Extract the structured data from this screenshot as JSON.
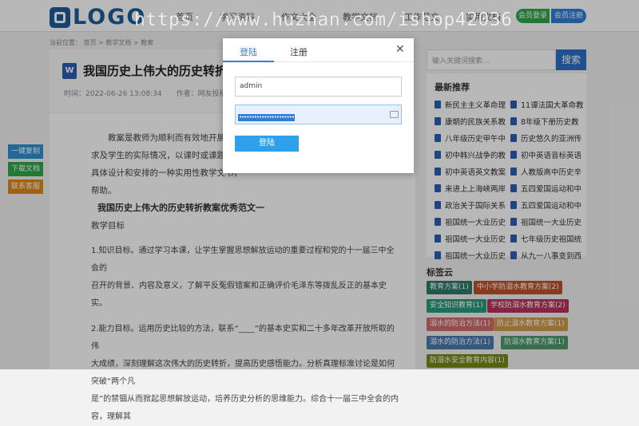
{
  "header": {
    "logo_text": "LOGO",
    "nav": [
      "首页",
      "学习资料",
      "作文大全",
      "教学文档",
      "工作范文",
      "实用文档"
    ],
    "member_login": "会员登录",
    "member_register": "会员注册",
    "watermark": "https://www.huzhan.com/ishop42036"
  },
  "breadcrumb": "当前位置： 首页 > 教学文档 > 教案",
  "article": {
    "title": "我国历史上伟大的历史转折",
    "meta": "时间：2022-06-26 13:08:34　　作者：网友投稿",
    "intro": [
      "教案是教师为顺利而有效地开展教",
      "求及学生的实际情况，以课时或课题为单位",
      "具体设计和安排的一种实用性教学文书，",
      "帮助。"
    ],
    "heading": "我国历史上伟大的历史转折教案优秀范文一",
    "subheading": "教学目标",
    "p1_lines": [
      "1.知识目标。通过学习本课，让学生掌握思想解放运动的重要过程和党的十一届三中全会的",
      "召开的背景、内容及意义，了解平反冤假错案和正确评价毛泽东等拨乱反正的基本史实。"
    ],
    "p2_lines": [
      "2.能力目标。运用历史比较的方法，联系“____”的基本史实和二十多年改革开放所取的伟",
      "大成绩，深刻理解这次伟大的历史转折，提高历史感悟能力。分析真理标准讨论是如何突破“两个凡",
      "是”的禁锢从而掀起思想解放运动，培养历史分析的思维能力。综合十一届三中全会的内容，理解其"
    ]
  },
  "side_buttons": [
    "一键复制",
    "下载文档",
    "联系客服"
  ],
  "sidebar": {
    "search_placeholder": "输入关键词搜索...",
    "search_button": "搜索",
    "recommend_title": "最新推荐",
    "recommend": [
      "新民主主义革命理",
      "11谭法国大革命教",
      "康朝的民族关系教",
      "8年级下册历史教",
      "八年级历史甲午中",
      "历史悠久的亚洲传",
      "初中韩兴战争的教",
      "初中英语音标英语",
      "初中英语英文教案",
      "人教版高中历史辛",
      "来进上上海峡两岸",
      "五四爱国运动和中",
      "政治关于国际关系",
      "五四爱国运动和中",
      "祖国统一大业历史",
      "祖国统一大业历史",
      "祖国统一大业历史",
      "七年级历史祖国统",
      "祖国统一大业历史",
      "从九一八事变到西"
    ],
    "tags_title": "标签云",
    "tags": [
      {
        "label": "教育方案(1)",
        "color": "#2b7a6a"
      },
      {
        "label": "中小学防溺水教育方案(2)",
        "color": "#c0522a"
      },
      {
        "label": "安全知识教育(1)",
        "color": "#2a9a7a"
      },
      {
        "label": "学校防溺水教育方案(2)",
        "color": "#b8325a"
      },
      {
        "label": "溺水的防治方法(1)",
        "color": "#d06a6a"
      },
      {
        "label": "防止溺水教育方案(1)",
        "color": "#d09a4a"
      },
      {
        "label": "溺水的防治方法(1)",
        "color": "#4a7ab0"
      },
      {
        "label": "防溺水教育方案(1)",
        "color": "#4a9a6a"
      },
      {
        "label": "防溺水安全教育内容(1)",
        "color": "#7a8a1a"
      }
    ]
  },
  "modal": {
    "tab_login": "登陆",
    "tab_register": "注册",
    "close": "✕",
    "username": "admin",
    "password_mask": "••••••••••••••••••••••",
    "submit": "登陆"
  }
}
